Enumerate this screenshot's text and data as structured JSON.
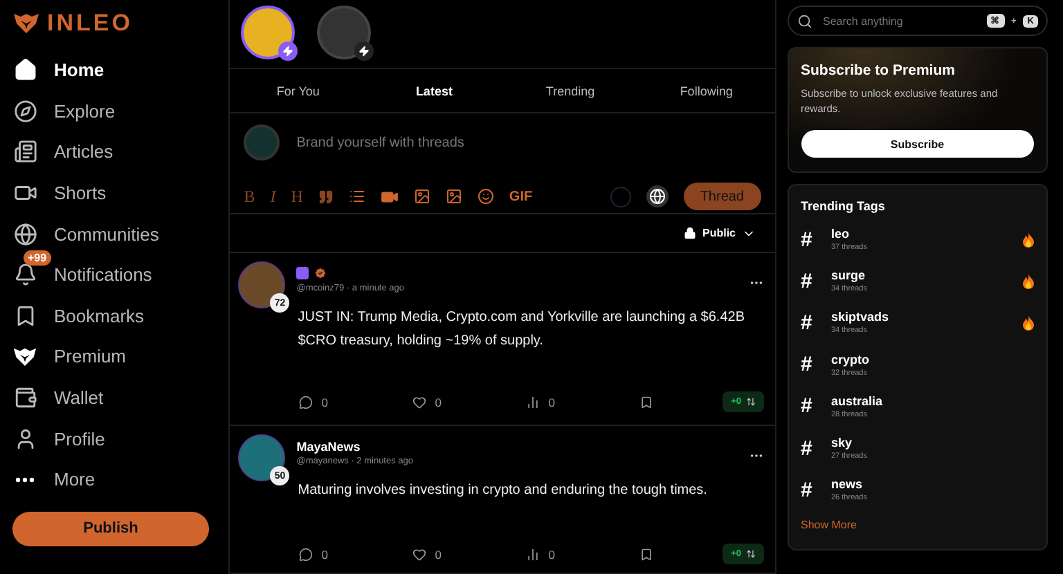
{
  "brand": {
    "name": "INLEO"
  },
  "nav": [
    {
      "label": "Home",
      "selected": true
    },
    {
      "label": "Explore",
      "selected": false
    },
    {
      "label": "Articles",
      "selected": false
    },
    {
      "label": "Shorts",
      "selected": false
    },
    {
      "label": "Communities",
      "selected": false
    },
    {
      "label": "Notifications",
      "selected": false,
      "badge": "+99"
    },
    {
      "label": "Bookmarks",
      "selected": false
    },
    {
      "label": "Premium",
      "selected": false
    },
    {
      "label": "Wallet",
      "selected": false
    },
    {
      "label": "Profile",
      "selected": false
    },
    {
      "label": "More",
      "selected": false
    }
  ],
  "publish_button": "Publish",
  "stories": [
    {
      "active": true
    },
    {
      "active": false
    }
  ],
  "feed_tabs": [
    {
      "label": "For You",
      "selected": false
    },
    {
      "label": "Latest",
      "selected": true
    },
    {
      "label": "Trending",
      "selected": false
    },
    {
      "label": "Following",
      "selected": false
    }
  ],
  "composer": {
    "placeholder": "Brand yourself with threads",
    "format_buttons": [
      "B",
      "I",
      "H"
    ],
    "gif_label": "GIF",
    "submit": "Thread",
    "audience": "Public"
  },
  "posts": [
    {
      "meta": "@mcoinz79 · a minute ago",
      "reputation": "72",
      "verified": true,
      "text": "JUST IN: Trump Media, Crypto.com and Yorkville are launching a $6.42B $CRO treasury, holding ~19% of supply.",
      "comments": "0",
      "likes": "0",
      "views": "0",
      "votes": "+0"
    },
    {
      "name": "MayaNews",
      "meta": "@mayanews · 2 minutes ago",
      "reputation": "50",
      "verified": false,
      "text": "Maturing involves investing in crypto and enduring the tough times.",
      "comments": "0",
      "likes": "0",
      "views": "0",
      "votes": "+0"
    }
  ],
  "search": {
    "placeholder": "Search anything",
    "keys": [
      "⌘",
      "+",
      "K"
    ]
  },
  "premium": {
    "title": "Subscribe to Premium",
    "text": "Subscribe to unlock exclusive features and rewards.",
    "button": "Subscribe"
  },
  "trending": {
    "title": "Trending Tags",
    "show_more": "Show More",
    "tags": [
      {
        "symbol": "#",
        "name": "leo",
        "count": "37 threads",
        "hot": true
      },
      {
        "symbol": "#",
        "name": "surge",
        "count": "34 threads",
        "hot": true
      },
      {
        "symbol": "#",
        "name": "skiptvads",
        "count": "34 threads",
        "hot": true
      },
      {
        "symbol": "#",
        "name": "crypto",
        "count": "32 threads",
        "hot": false
      },
      {
        "symbol": "#",
        "name": "australia",
        "count": "28 threads",
        "hot": false
      },
      {
        "symbol": "#",
        "name": "sky",
        "count": "27 threads",
        "hot": false
      },
      {
        "symbol": "#",
        "name": "news",
        "count": "26 threads",
        "hot": false
      }
    ]
  }
}
